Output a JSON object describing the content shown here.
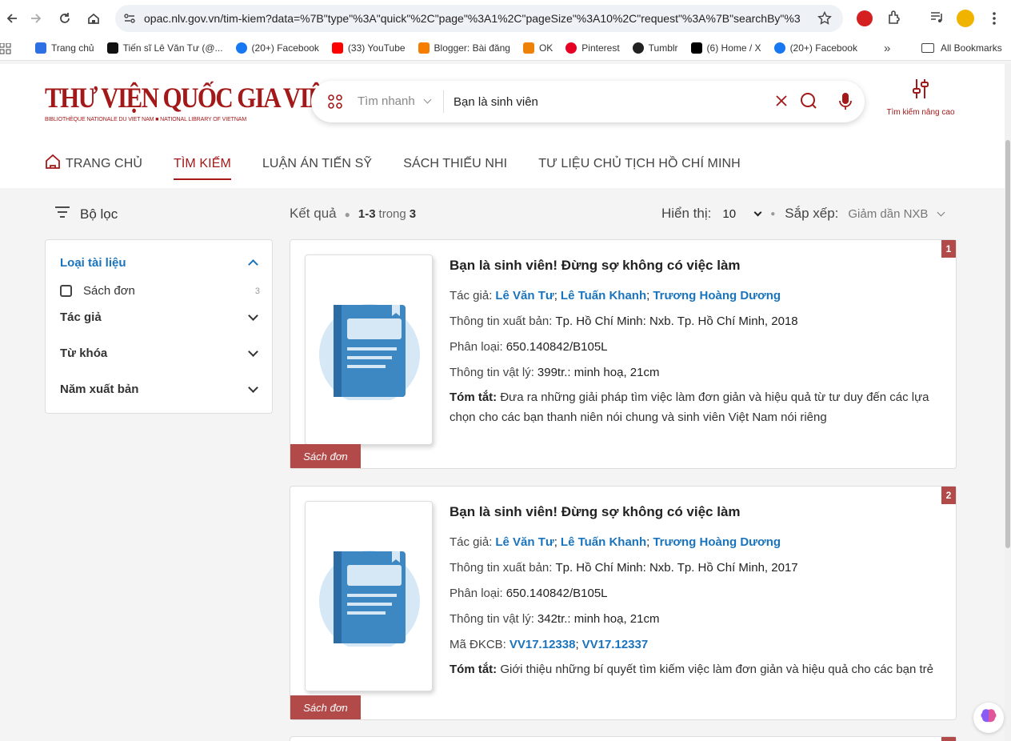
{
  "browser": {
    "url": "opac.nlv.gov.vn/tim-kiem?data=%7B\"type\"%3A\"quick\"%2C\"page\"%3A1%2C\"pageSize\"%3A10%2C\"request\"%3A%7B\"searchBy\"%3A...",
    "bookmarks": [
      "Trang chủ",
      "Tiến sĩ Lê Văn Tư (@...",
      "(20+) Facebook",
      "(33) YouTube",
      "Blogger: Bài đăng",
      "OK",
      "Pinterest",
      "Tumblr",
      "(6) Home / X",
      "(20+) Facebook"
    ],
    "all_bookmarks": "All Bookmarks",
    "more": "»"
  },
  "header": {
    "logo_title": "THƯ VIỆN QUỐC GIA VIỆT NAM",
    "logo_subtitle": "BIBLIOTHÈQUE NATIONALE DU VIET NAM  ■  NATIONAL LIBRARY OF VIETNAM",
    "search_mode": "Tìm nhanh",
    "search_value": "Bạn là sinh viên",
    "advanced_label": "Tìm kiếm nâng cao"
  },
  "nav": {
    "home": "TRANG CHỦ",
    "search": "TÌM KIẾM",
    "thesis": "LUẬN ÁN TIẾN SỸ",
    "kids": "SÁCH THIẾU NHI",
    "hcm": "TƯ LIỆU CHỦ TỊCH HỒ CHÍ MINH"
  },
  "filter": {
    "title": "Bộ lọc",
    "doc_type": "Loại tài liệu",
    "option_label": "Sách đơn",
    "option_count": "3",
    "author": "Tác giả",
    "keyword": "Từ khóa",
    "year": "Năm xuất bản"
  },
  "results": {
    "label": "Kết quả",
    "range": "1-3",
    "of_label": "trong",
    "total": "3",
    "display_label": "Hiển thị:",
    "display_value": "10",
    "sort_label": "Sắp xếp:",
    "sort_value": "Giảm dần NXB"
  },
  "labels": {
    "author": "Tác giả:",
    "publish": "Thông tin xuất bản:",
    "classify": "Phân loại:",
    "physical": "Thông tin vật lý:",
    "code": "Mã ĐKCB:",
    "summary": "Tóm tắt:",
    "badge": "Sách đơn"
  },
  "items": [
    {
      "num": "1",
      "title": "Bạn là sinh viên! Đừng sợ không có việc làm",
      "authors": [
        "Lê Văn Tư",
        "Lê Tuấn Khanh",
        "Trương Hoàng Dương"
      ],
      "publish": "Tp. Hồ Chí Minh: Nxb. Tp. Hồ Chí Minh, 2018",
      "classify": "650.140842/B105L",
      "physical": "399tr.: minh hoạ, 21cm",
      "summary": "Đưa ra những giải pháp tìm việc làm đơn giản và hiệu quả từ tư duy đến các lựa chọn cho các bạn thanh niên nói chung và sinh viên Việt Nam nói riêng"
    },
    {
      "num": "2",
      "title": "Bạn là sinh viên! Đừng sợ không có việc làm",
      "authors": [
        "Lê Văn Tư",
        "Lê Tuấn Khanh",
        "Trương Hoàng Dương"
      ],
      "publish": "Tp. Hồ Chí Minh: Nxb. Tp. Hồ Chí Minh, 2017",
      "classify": "650.140842/B105L",
      "physical": "342tr.: minh hoạ, 21cm",
      "codes": [
        "VV17.12338",
        "VV17.12337"
      ],
      "summary": "Giới thiệu những bí quyết tìm kiếm việc làm đơn giản và hiệu quả cho các bạn trẻ"
    }
  ],
  "colors": {
    "brand": "#a31919",
    "link": "#1a74bd",
    "badge": "#b34a4a"
  }
}
